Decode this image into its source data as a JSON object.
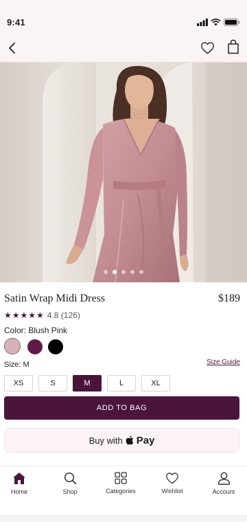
{
  "status_bar": {
    "time": "9:41"
  },
  "nav": {
    "back_icon": "chevron-left-icon",
    "wishlist_icon": "heart-icon",
    "bag_icon": "shopping-bag-icon"
  },
  "carousel": {
    "image_count": 5,
    "active_index": 1
  },
  "product": {
    "title": "Satin Wrap Midi Dress",
    "price": "$189",
    "stars": "★★★★★",
    "rating": 4.8,
    "rating_text": "4.8 (126)",
    "color_label": "Color: Blush Pink",
    "swatches": [
      {
        "name": "Blush Pink",
        "hex": "#d9b0b8",
        "selected": true
      },
      {
        "name": "Plum",
        "hex": "#5e1b47",
        "selected": false
      },
      {
        "name": "Black",
        "hex": "#000000",
        "selected": false
      }
    ],
    "size_label": "Size: M",
    "size_guide": "Size Guide",
    "sizes": [
      "XS",
      "S",
      "M",
      "L",
      "XL"
    ],
    "selected_size": "M"
  },
  "actions": {
    "add_to_bag": "ADD TO BAG",
    "buy_with": "Buy with",
    "pay": "Pay"
  },
  "tabs": [
    {
      "label": "Home",
      "icon": "home-icon",
      "active": true
    },
    {
      "label": "Shop",
      "icon": "search-icon",
      "active": false
    },
    {
      "label": "Categories",
      "icon": "grid-icon",
      "active": false
    },
    {
      "label": "Wishlist",
      "icon": "heart-icon",
      "active": false
    },
    {
      "label": "Account",
      "icon": "user-icon",
      "active": false
    }
  ],
  "colors": {
    "accent": "#4a1538",
    "header_bg": "#fbf4f6"
  }
}
